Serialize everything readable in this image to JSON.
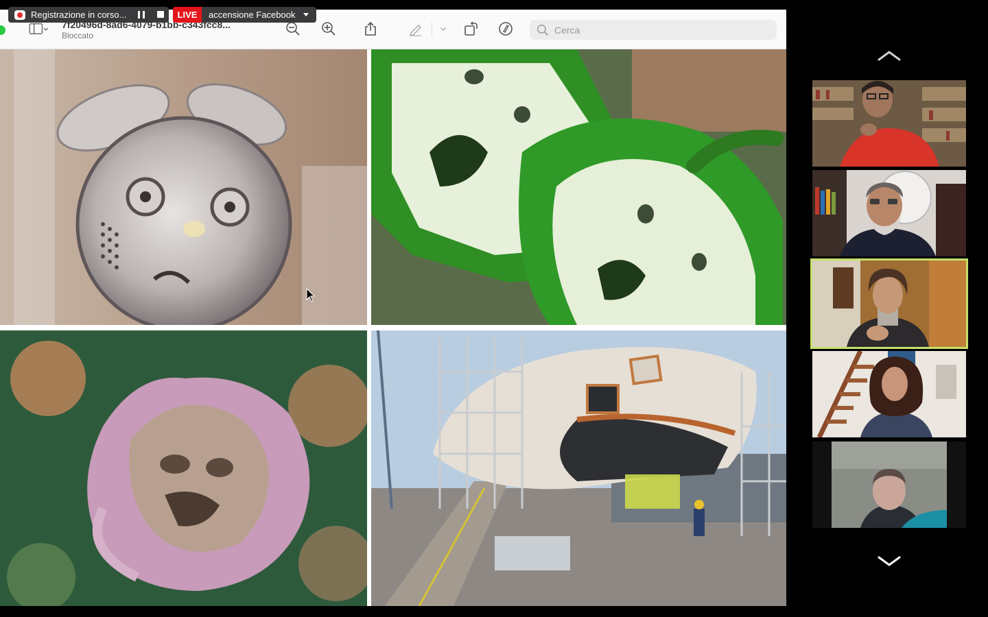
{
  "recording": {
    "status_label": "Registrazione in corso...",
    "pause_icon": "pause-icon",
    "stop_icon": "stop-icon"
  },
  "livestream": {
    "badge": "LIVE",
    "target": "accensione Facebook"
  },
  "preview": {
    "title": "7f20496d-8ad6-4079-b1bb-c343fcc8...",
    "subtitle": "Bloccato",
    "search_placeholder": "Cerca",
    "colors": {
      "accent_green": "#29c940",
      "active_speaker": "#c5e06b",
      "live_red": "#e3141b"
    }
  },
  "gallery": {
    "participants": [
      {
        "id": "p1",
        "active": false
      },
      {
        "id": "p2",
        "active": false
      },
      {
        "id": "p3",
        "active": true
      },
      {
        "id": "p4",
        "active": false
      },
      {
        "id": "p5",
        "active": false
      }
    ]
  }
}
